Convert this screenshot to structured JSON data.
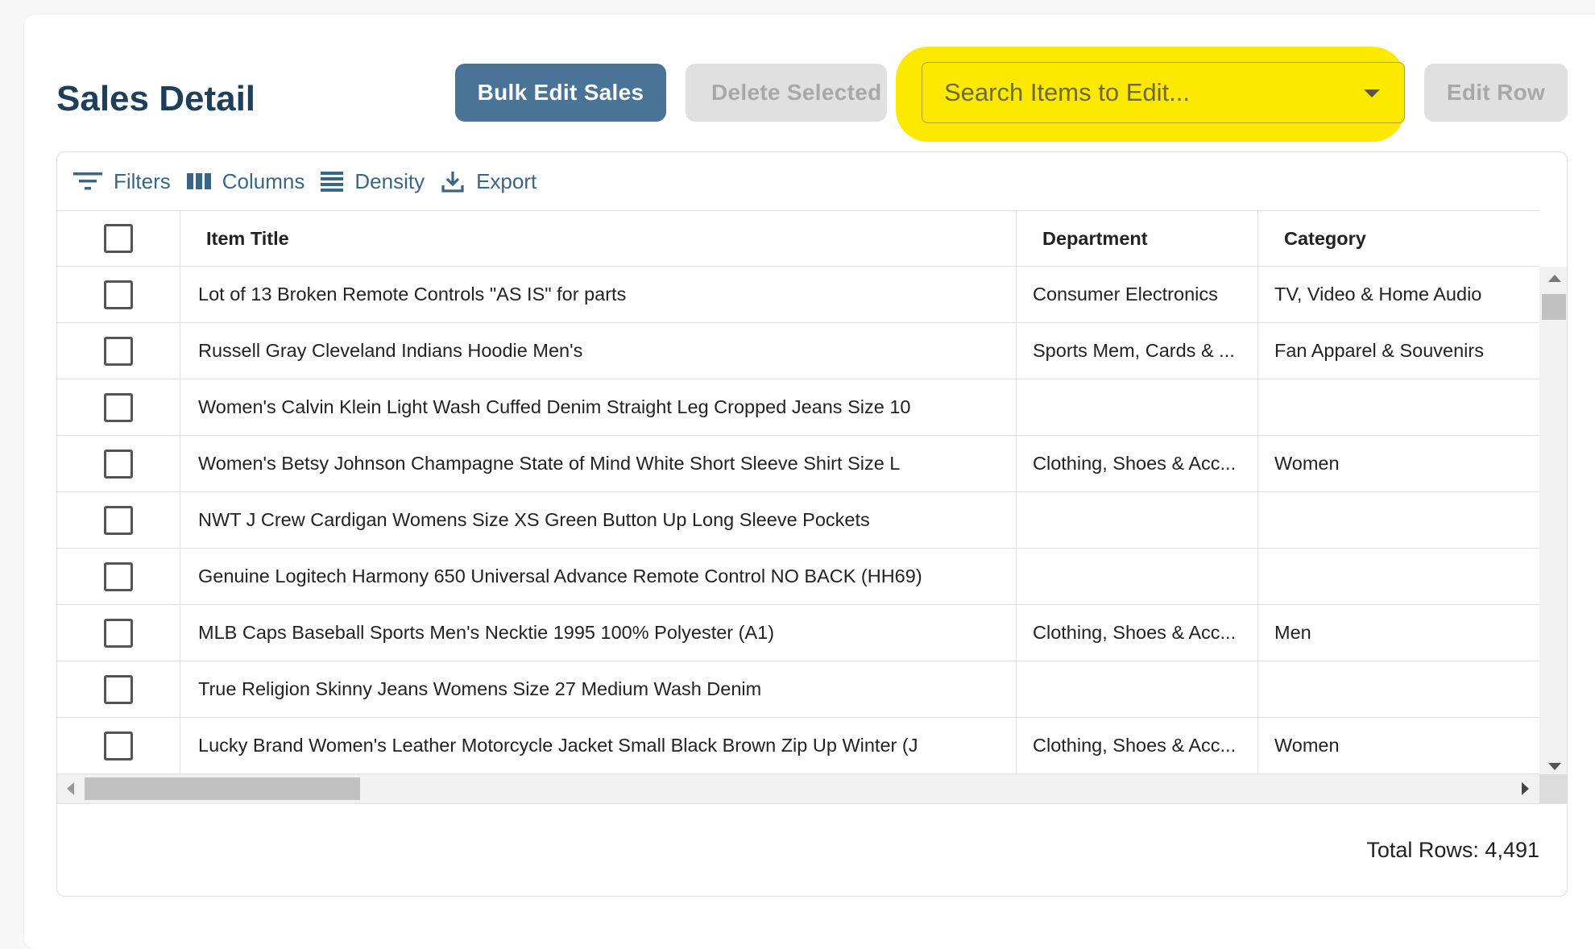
{
  "header": {
    "title": "Sales Detail",
    "bulk_edit_label": "Bulk Edit Sales",
    "delete_label": "Delete Selected",
    "search_placeholder": "Search Items to Edit...",
    "edit_row_label": "Edit Row"
  },
  "toolbar": {
    "filters": "Filters",
    "columns": "Columns",
    "density": "Density",
    "export": "Export"
  },
  "columns": {
    "title": "Item Title",
    "department": "Department",
    "category": "Category"
  },
  "rows": [
    {
      "title": "Lot of 13 Broken Remote Controls \"AS IS\" for parts",
      "department": "Consumer Electronics",
      "category": "TV, Video & Home Audio"
    },
    {
      "title": "Russell Gray Cleveland Indians Hoodie Men's",
      "department": "Sports Mem, Cards & ...",
      "category": "Fan Apparel & Souvenirs"
    },
    {
      "title": "Women's Calvin Klein Light Wash Cuffed Denim Straight Leg Cropped Jeans Size 10",
      "department": "",
      "category": ""
    },
    {
      "title": "Women's Betsy Johnson Champagne State of Mind White Short Sleeve Shirt Size L",
      "department": "Clothing, Shoes & Acc...",
      "category": "Women"
    },
    {
      "title": "NWT J Crew Cardigan Womens Size XS Green Button Up Long Sleeve Pockets",
      "department": "",
      "category": ""
    },
    {
      "title": "Genuine Logitech Harmony 650 Universal Advance Remote Control NO BACK (HH69)",
      "department": "",
      "category": ""
    },
    {
      "title": "MLB Caps Baseball Sports Men's Necktie 1995 100% Polyester (A1)",
      "department": "Clothing, Shoes & Acc...",
      "category": "Men"
    },
    {
      "title": "True Religion Skinny Jeans Womens Size 27 Medium Wash Denim",
      "department": "",
      "category": ""
    },
    {
      "title": "Lucky Brand Women's Leather Motorcycle Jacket Small Black Brown Zip Up Winter (J",
      "department": "Clothing, Shoes & Acc...",
      "category": "Women"
    }
  ],
  "footer": {
    "total_rows": "Total Rows: 4,491"
  }
}
